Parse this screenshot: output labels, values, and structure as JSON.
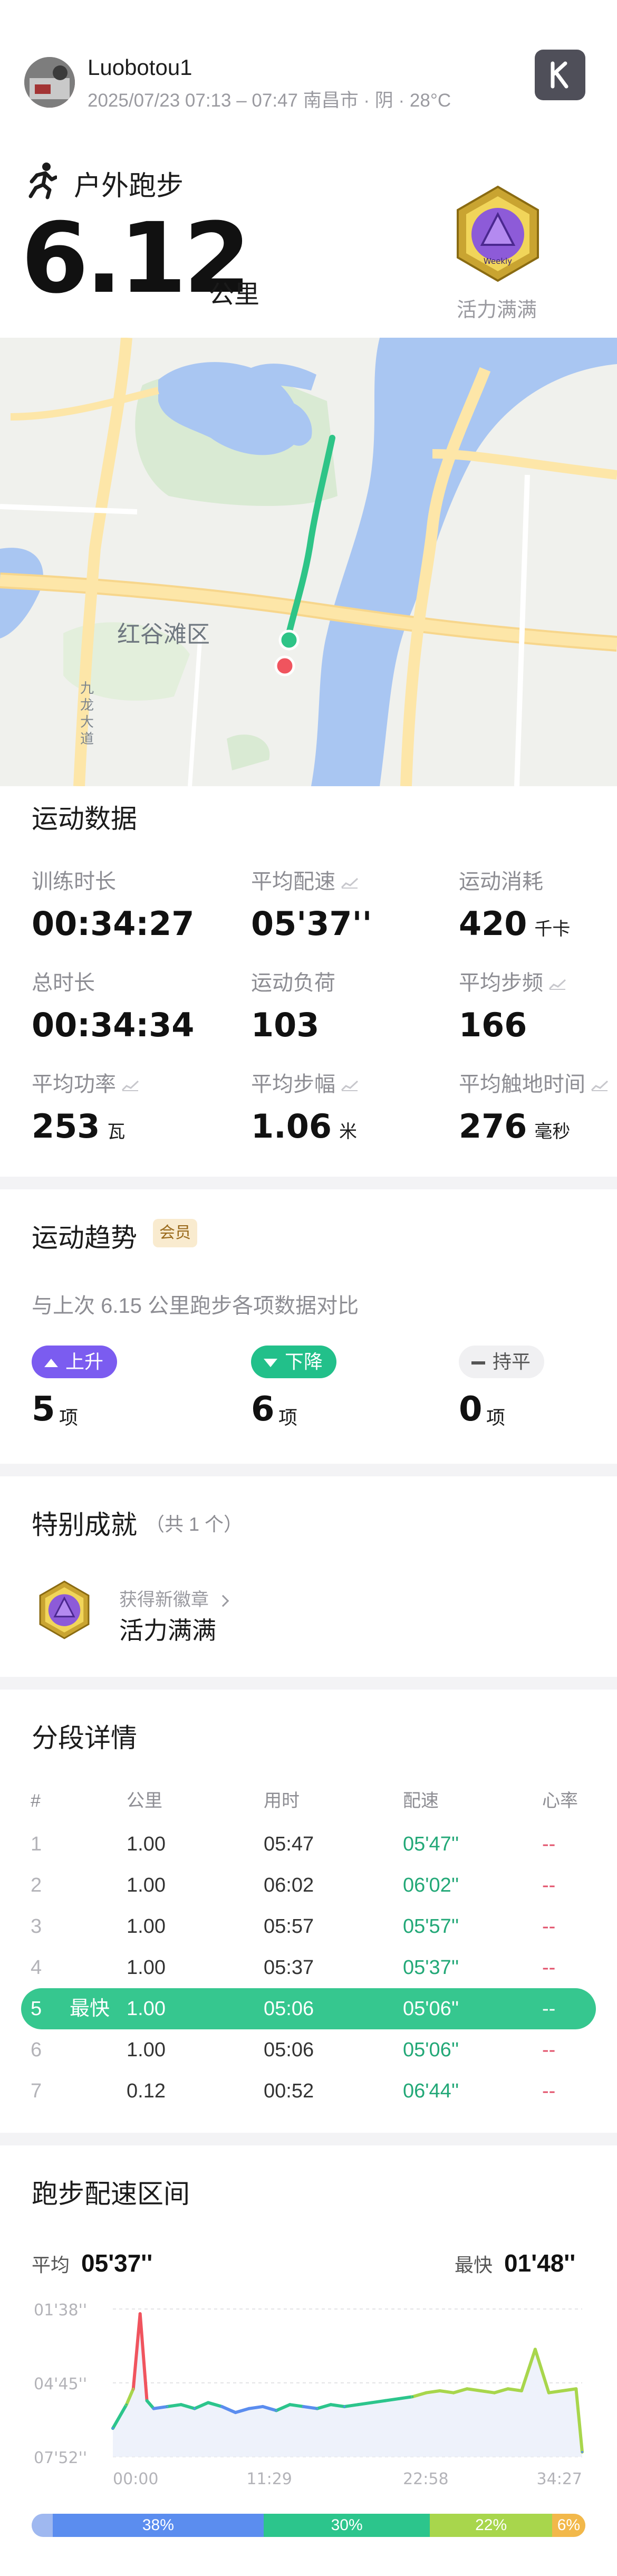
{
  "header": {
    "username": "Luobotou1",
    "meta": "2025/07/23 07:13 – 07:47 南昌市 · 阴 · 28°C",
    "app_icon": "K"
  },
  "summary": {
    "activity_icon": "runner-icon",
    "activity": "户外跑步",
    "distance": "6.12",
    "distance_unit": "公里",
    "badge_text": "Weekly",
    "badge_label": "活力满满"
  },
  "map": {
    "labels": [
      "红谷滩区",
      "九龙大道"
    ]
  },
  "stats": {
    "title": "运动数据",
    "items": [
      {
        "label": "训练时长",
        "value": "00:34:27",
        "unit": "",
        "trend": false
      },
      {
        "label": "平均配速",
        "value": "05'37''",
        "unit": "",
        "trend": true
      },
      {
        "label": "运动消耗",
        "value": "420",
        "unit": "千卡",
        "trend": false
      },
      {
        "label": "总时长",
        "value": "00:34:34",
        "unit": "",
        "trend": false
      },
      {
        "label": "运动负荷",
        "value": "103",
        "unit": "",
        "trend": false
      },
      {
        "label": "平均步频",
        "value": "166",
        "unit": "",
        "trend": true
      },
      {
        "label": "平均功率",
        "value": "253",
        "unit": "瓦",
        "trend": true
      },
      {
        "label": "平均步幅",
        "value": "1.06",
        "unit": "米",
        "trend": true
      },
      {
        "label": "平均触地时间",
        "value": "276",
        "unit": "毫秒",
        "trend": true
      }
    ]
  },
  "trend": {
    "title": "运动趋势",
    "member_badge": "会员",
    "subtitle": "与上次 6.15 公里跑步各项数据对比",
    "items": [
      {
        "label": "上升",
        "count": "5",
        "unit": "项",
        "color": "#7b5cf0"
      },
      {
        "label": "下降",
        "count": "6",
        "unit": "项",
        "color": "#22c08a"
      },
      {
        "label": "持平",
        "count": "0",
        "unit": "项",
        "color": "#f0f0f2"
      }
    ]
  },
  "achievement": {
    "title": "特别成就",
    "count_text": "（共 1 个）",
    "hint": "获得新徽章",
    "name": "活力满满"
  },
  "splits": {
    "title": "分段详情",
    "headers": [
      "#",
      "公里",
      "用时",
      "配速",
      "心率"
    ],
    "fastest_label": "最快",
    "rows": [
      {
        "n": "1",
        "km": "1.00",
        "time": "05:47",
        "pace": "05'47''",
        "hr": "--"
      },
      {
        "n": "2",
        "km": "1.00",
        "time": "06:02",
        "pace": "06'02''",
        "hr": "--"
      },
      {
        "n": "3",
        "km": "1.00",
        "time": "05:57",
        "pace": "05'57''",
        "hr": "--"
      },
      {
        "n": "4",
        "km": "1.00",
        "time": "05:37",
        "pace": "05'37''",
        "hr": "--"
      },
      {
        "n": "5",
        "km": "1.00",
        "time": "05:06",
        "pace": "05'06''",
        "hr": "--"
      },
      {
        "n": "6",
        "km": "1.00",
        "time": "05:06",
        "pace": "05'06''",
        "hr": "--"
      },
      {
        "n": "7",
        "km": "0.12",
        "time": "00:52",
        "pace": "06'44''",
        "hr": "--"
      }
    ]
  },
  "pace_chart": {
    "title": "跑步配速区间",
    "avg_label": "平均",
    "avg_value": "05'37''",
    "best_label": "最快",
    "best_value": "01'48''",
    "distribution": [
      {
        "label": "38%",
        "value": 38,
        "color": "#5b8def"
      },
      {
        "label": "30%",
        "value": 30,
        "color": "#2cc58c"
      },
      {
        "label": "22%",
        "value": 22,
        "color": "#a8d64c"
      },
      {
        "label": "6%",
        "value": 6,
        "color": "#f2b84a"
      }
    ]
  },
  "chart_data": {
    "type": "line",
    "title": "",
    "xlabel": "",
    "ylabel": "",
    "x_ticks": [
      "00:00",
      "11:29",
      "22:58",
      "34:27"
    ],
    "y_ticks": [
      "01'38''",
      "04'45''",
      "07'52''"
    ],
    "x_seconds": [
      0,
      60,
      90,
      120,
      150,
      180,
      240,
      300,
      360,
      420,
      480,
      540,
      600,
      660,
      720,
      780,
      840,
      900,
      960,
      1020,
      1080,
      1140,
      1200,
      1260,
      1320,
      1380,
      1440,
      1500,
      1560,
      1620,
      1680,
      1740,
      1800,
      1860,
      1920,
      1980,
      2040,
      2067
    ],
    "y_pace_seconds": [
      400,
      340,
      300,
      110,
      330,
      350,
      345,
      340,
      350,
      335,
      345,
      360,
      350,
      345,
      355,
      340,
      345,
      350,
      340,
      345,
      340,
      335,
      330,
      325,
      320,
      310,
      305,
      310,
      300,
      305,
      310,
      300,
      305,
      200,
      310,
      305,
      300,
      460
    ],
    "ylim": [
      98,
      472
    ]
  }
}
